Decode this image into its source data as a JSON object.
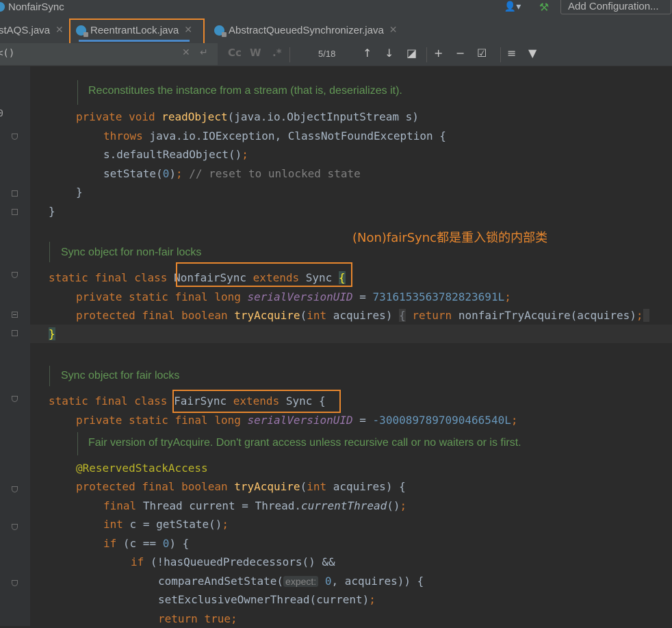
{
  "window": {
    "breadcrumb": "NonfairSync",
    "add_configuration": "Add Configuration..."
  },
  "tabs": [
    {
      "label": "stAQS.java"
    },
    {
      "label": "ReentrantLock.java"
    },
    {
      "label": "AbstractQueuedSynchronizer.java"
    }
  ],
  "find": {
    "query": "<()",
    "case_label": "Cc",
    "words_label": "W",
    "regex_label": ".*",
    "counter": "5/18"
  },
  "gutter": {
    "partial_number": "0"
  },
  "code": {
    "doc1": "Reconstitutes the instance from a stream (that is, deserializes it).",
    "l1": [
      "private",
      "void",
      "readObject",
      "(java.io.ObjectInputStream s)"
    ],
    "l2": [
      "throws",
      "java.io.IOException, ClassNotFoundException {"
    ],
    "l3": "s.defaultReadObject()",
    "l4": [
      "setState(",
      "0",
      ")",
      ";",
      "// reset to unlocked state"
    ],
    "l5": "}",
    "l6": "}",
    "doc2": "Sync object for non-fair locks",
    "l7": [
      "static",
      "final",
      "class",
      "NonfairSync",
      "extends",
      "Sync",
      "{"
    ],
    "l8": [
      "private",
      "static",
      "final",
      "long",
      "serialVersionUID",
      "=",
      "7316153563782823691L"
    ],
    "l9": [
      "protected",
      "final",
      "boolean",
      "tryAcquire",
      "(",
      "int",
      "acquires)",
      "{",
      "return",
      "nonfairTryAcquire(acquires)"
    ],
    "l10": "}",
    "doc3": "Sync object for fair locks",
    "l11": [
      "static",
      "final",
      "class",
      "FairSync",
      "extends",
      "Sync {"
    ],
    "l12": [
      "private",
      "static",
      "final",
      "long",
      "serialVersionUID",
      "=",
      "-3000897897090466540L"
    ],
    "doc4": "Fair version of tryAcquire. Don't grant access unless recursive call or no waiters or is first.",
    "l13": "@ReservedStackAccess",
    "l14": [
      "protected",
      "final",
      "boolean",
      "tryAcquire",
      "(",
      "int",
      "acquires) {"
    ],
    "l15": [
      "final",
      "Thread current = Thread.",
      "currentThread",
      "()"
    ],
    "l16": [
      "int",
      "c = getState()"
    ],
    "l17": [
      "if",
      "(c == ",
      "0",
      ") {"
    ],
    "l18": [
      "if",
      "(!hasQueuedPredecessors() &&"
    ],
    "l19": [
      "compareAndSetState(",
      "expect:",
      "0",
      ", acquires)) {"
    ],
    "l20": "setExclusiveOwnerThread(current)",
    "l21": [
      "return",
      "true"
    ]
  },
  "annotation": "(Non)fairSync都是重入锁的内部类",
  "colors": {
    "keyword": "#cc7832",
    "method": "#ffc66d",
    "number": "#6897bb",
    "doc": "#629755",
    "highlight": "#e8872e",
    "field": "#9876aa"
  }
}
